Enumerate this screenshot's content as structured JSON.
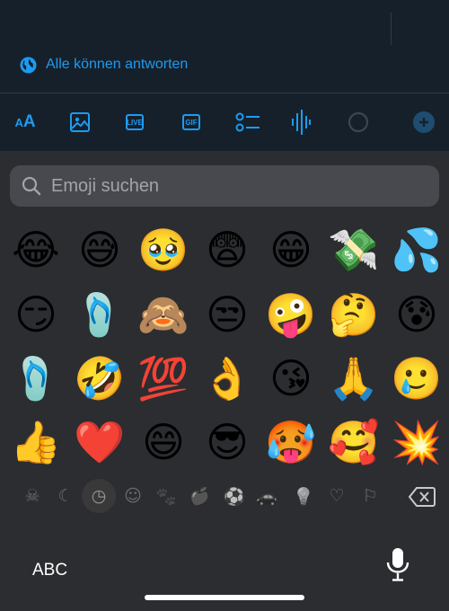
{
  "composer": {
    "reply_setting": "Alle können antworten"
  },
  "toolbar": {
    "font_label": "AA",
    "live_label": "LIVE",
    "gif_label": "GIF"
  },
  "emoji_search": {
    "placeholder": "Emoji suchen"
  },
  "emojis": {
    "rows": [
      [
        "😂",
        "😅",
        "🥹",
        "😨",
        "😁",
        "💸",
        "💦"
      ],
      [
        "😏",
        "🩴",
        "🙈",
        "😒",
        "🤪",
        "🤔",
        "😰"
      ],
      [
        "🩴",
        "🤣",
        "💯",
        "👌",
        "😘",
        "🙏",
        "🥲"
      ],
      [
        "👍",
        "❤️",
        "😄",
        "😎",
        "🥵",
        "🥰",
        "💥"
      ]
    ]
  },
  "categories": [
    {
      "name": "skull",
      "glyph": "☠"
    },
    {
      "name": "moon",
      "glyph": "☾"
    },
    {
      "name": "recent",
      "glyph": "◷"
    },
    {
      "name": "smileys",
      "glyph": "☺"
    },
    {
      "name": "animals",
      "glyph": "🐾"
    },
    {
      "name": "food",
      "glyph": "🍎"
    },
    {
      "name": "activity",
      "glyph": "⚽"
    },
    {
      "name": "travel",
      "glyph": "🚗"
    },
    {
      "name": "objects",
      "glyph": "💡"
    },
    {
      "name": "symbols",
      "glyph": "♡"
    },
    {
      "name": "flags",
      "glyph": "⚐"
    }
  ],
  "keyboard": {
    "abc_label": "ABC"
  },
  "colors": {
    "accent": "#1d9bf0",
    "composer_bg": "#16202b",
    "keyboard_bg": "#2b2d31"
  }
}
